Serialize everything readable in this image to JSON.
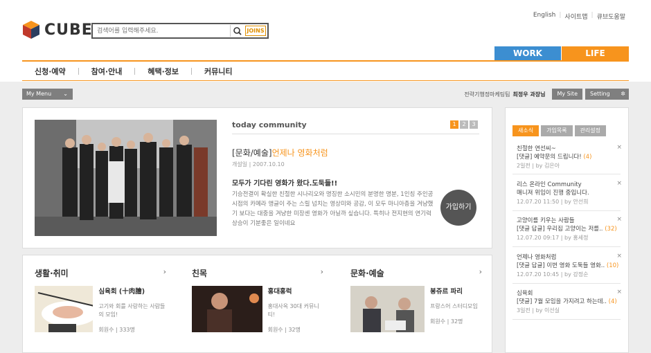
{
  "util_links": [
    "English",
    "사이트맵",
    "큐브도움말"
  ],
  "logo": {
    "name": "CUBE"
  },
  "search": {
    "placeholder": "검색어를 입력해주세요.",
    "joins_label": "JOINS"
  },
  "top_tabs": {
    "work": "WORK",
    "life": "LIFE"
  },
  "nav": [
    "신청·예약",
    "참여·안내",
    "혜택·정보",
    "커뮤니티"
  ],
  "mymenu": "My Menu",
  "user": {
    "dept": "전략기행정마케팅팀",
    "name": "최정우 과장님",
    "mysite": "My Site",
    "setting": "Setting"
  },
  "today": {
    "title": "today community",
    "pages": [
      "1",
      "2",
      "3"
    ],
    "community_bracket": "[문화/예술]",
    "community_name": "언제나 영화처럼",
    "meta": "개설일 | 2007.10.10",
    "post_title": "모두가 기다린 영화가 왔다.도둑들!!",
    "post_body": "기승전결이 확실한 친절한 시나리오와 명징한 소시민의 분명한 명분, 1인칭 주인공 시점의 카메라 앵글이 주는 스릴 넘치는 영상미와 공감, 이 모두 마니아층을 겨냥했기 보다는 대중을 겨냥한 미장센 영화가 아닐까 싶습니다. 특히나 전지현의 연기력 상승이 기분좋은 일이네요",
    "join": "가입하기"
  },
  "categories": [
    {
      "title": "생활·취미",
      "name": "심육회 (十肉膾)",
      "desc": "고기와 회를 사랑하는 사람들의 모임!",
      "meta": "회원수 | 333명"
    },
    {
      "title": "친목",
      "name": "홍대홍럭",
      "desc": "홍대사옥 30대 커뮤니티!",
      "meta": "회원수 | 32명"
    },
    {
      "title": "문화·예술",
      "name": "봉쥬르 파리",
      "desc": "프랑스어 스터디모임",
      "meta": "회원수 | 32명"
    }
  ],
  "side_tabs": [
    "새소식",
    "가입목록",
    "관리설정"
  ],
  "news": [
    {
      "l1": "친절한 연선씨~",
      "l2": "[댓글] 예약문의 드립니다!",
      "count": "(4)",
      "meta": "2일전 | by 김은아"
    },
    {
      "l1": "리스 온라인 Community",
      "l2": "매니져 위임이 진행 중입니다.",
      "count": "",
      "meta": "12.07.20 11:50 | by 안선희"
    },
    {
      "l1": "고양이를 키우는 사람들",
      "l2": "[댓글 답글] 우리집 고양이는 저를..",
      "count": "(32)",
      "meta": "12.07.20 09:17 | by 홍세정"
    },
    {
      "l1": "언제나 영화처럼",
      "l2": "[댓글 답글] 이번 영화 도둑들 영화..",
      "count": "(10)",
      "meta": "12.07.20 10:45 | by 강정순"
    },
    {
      "l1": "심육회",
      "l2": "[댓글] 7월 모임을 가지려고 하는데..",
      "count": "(4)",
      "meta": "3일전 | by 이선실"
    }
  ]
}
